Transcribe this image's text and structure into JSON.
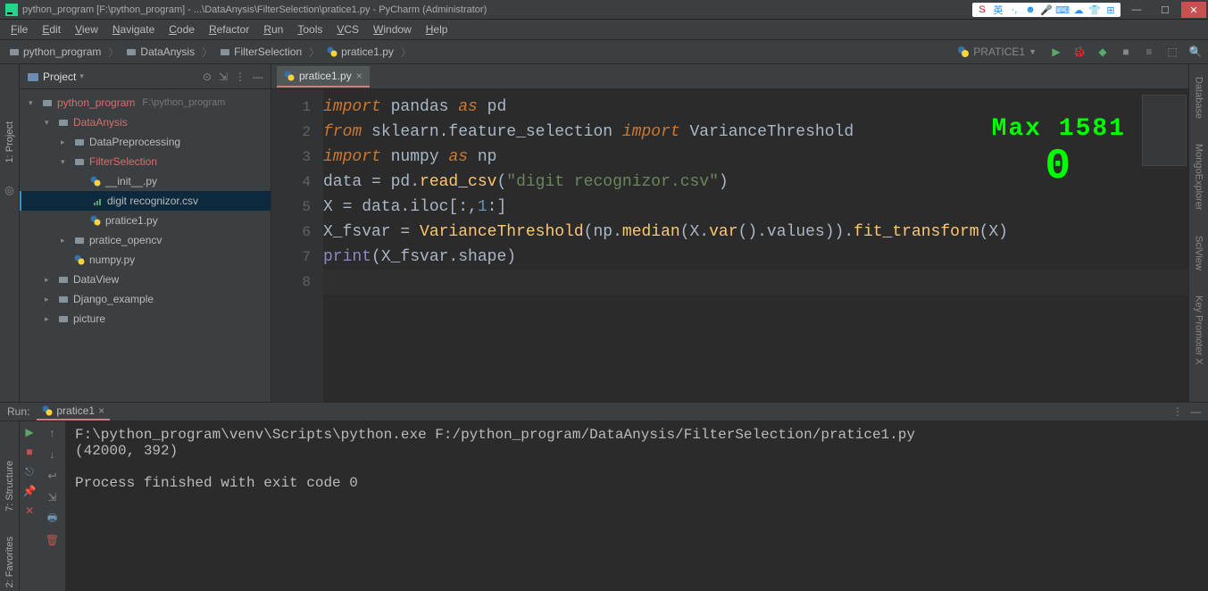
{
  "title": "python_program [F:\\python_program] - ...\\DataAnysis\\FilterSelection\\pratice1.py - PyCharm (Administrator)",
  "menu": [
    "File",
    "Edit",
    "View",
    "Navigate",
    "Code",
    "Refactor",
    "Run",
    "Tools",
    "VCS",
    "Window",
    "Help"
  ],
  "breadcrumbs": [
    {
      "icon": "folder",
      "label": "python_program"
    },
    {
      "icon": "folder",
      "label": "DataAnysis"
    },
    {
      "icon": "folder",
      "label": "FilterSelection"
    },
    {
      "icon": "python",
      "label": "pratice1.py"
    }
  ],
  "run_config": "PRATICE1",
  "project_header": "Project",
  "tree": [
    {
      "depth": 0,
      "arrow": "▾",
      "icon": "folder",
      "label": "python_program",
      "extra": "F:\\python_program",
      "cls": "root"
    },
    {
      "depth": 1,
      "arrow": "▾",
      "icon": "folder",
      "label": "DataAnysis",
      "cls": "folder-open"
    },
    {
      "depth": 2,
      "arrow": "▸",
      "icon": "folder",
      "label": "DataPreprocessing"
    },
    {
      "depth": 2,
      "arrow": "▾",
      "icon": "folder",
      "label": "FilterSelection",
      "cls": "folder-open"
    },
    {
      "depth": 3,
      "arrow": "",
      "icon": "python",
      "label": "__init__.py"
    },
    {
      "depth": 3,
      "arrow": "",
      "icon": "csv",
      "label": "digit recognizor.csv",
      "selected": true
    },
    {
      "depth": 3,
      "arrow": "",
      "icon": "python",
      "label": "pratice1.py"
    },
    {
      "depth": 2,
      "arrow": "▸",
      "icon": "folder",
      "label": "pratice_opencv"
    },
    {
      "depth": 2,
      "arrow": "",
      "icon": "python",
      "label": "numpy.py"
    },
    {
      "depth": 1,
      "arrow": "▸",
      "icon": "folder",
      "label": "DataView"
    },
    {
      "depth": 1,
      "arrow": "▸",
      "icon": "folder",
      "label": "Django_example"
    },
    {
      "depth": 1,
      "arrow": "▸",
      "icon": "folder",
      "label": "picture"
    }
  ],
  "editor_tab": "pratice1.py",
  "code": [
    [
      {
        "t": "import",
        "c": "kw"
      },
      {
        "t": " pandas "
      },
      {
        "t": "as",
        "c": "kw"
      },
      {
        "t": " pd"
      }
    ],
    [
      {
        "t": "from",
        "c": "kw"
      },
      {
        "t": " sklearn.feature_selection "
      },
      {
        "t": "import",
        "c": "kw"
      },
      {
        "t": " VarianceThreshold"
      }
    ],
    [
      {
        "t": "import",
        "c": "kw"
      },
      {
        "t": " numpy "
      },
      {
        "t": "as",
        "c": "kw"
      },
      {
        "t": " np"
      }
    ],
    [
      {
        "t": "data = pd."
      },
      {
        "t": "read_csv",
        "c": "fn"
      },
      {
        "t": "("
      },
      {
        "t": "\"digit recognizor.csv\"",
        "c": "str"
      },
      {
        "t": ")"
      }
    ],
    [
      {
        "t": "X = data.iloc[:,"
      },
      {
        "t": "1",
        "c": "num"
      },
      {
        "t": ":]"
      }
    ],
    [
      {
        "t": "X_fsvar = "
      },
      {
        "t": "VarianceThreshold",
        "c": "fn"
      },
      {
        "t": "(np."
      },
      {
        "t": "median",
        "c": "fn"
      },
      {
        "t": "(X."
      },
      {
        "t": "var",
        "c": "fn"
      },
      {
        "t": "().values))."
      },
      {
        "t": "fit_transform",
        "c": "fn"
      },
      {
        "t": "(X)"
      }
    ],
    [
      {
        "t": "print",
        "c": "builtin"
      },
      {
        "t": "(X_fsvar.shape)"
      }
    ],
    [
      {
        "t": ""
      }
    ]
  ],
  "overlay": {
    "line1": "Max 1581",
    "line2": "0"
  },
  "run_label": "Run:",
  "run_tab": "pratice1",
  "console": "F:\\python_program\\venv\\Scripts\\python.exe F:/python_program/DataAnysis/FilterSelection/pratice1.py\n(42000, 392)\n\nProcess finished with exit code 0",
  "left_rail": [
    "1: Project"
  ],
  "run_left_rail": [
    "7: Structure",
    "2: Favorites"
  ],
  "right_rail": [
    "Database",
    "MongoExplorer",
    "SciView",
    "Key Promoter X"
  ],
  "nav_tools": [
    {
      "name": "run",
      "color": "#59a869",
      "glyph": "▶"
    },
    {
      "name": "debug",
      "color": "#59a869",
      "glyph": "🐞"
    },
    {
      "name": "coverage",
      "color": "#59a869",
      "glyph": "◆"
    },
    {
      "name": "stop",
      "color": "#888",
      "glyph": "■"
    },
    {
      "name": "profile",
      "color": "#888",
      "glyph": "≡"
    },
    {
      "name": "update",
      "color": "#888",
      "glyph": "⬚"
    },
    {
      "name": "search",
      "color": "#3592c4",
      "glyph": "🔍"
    }
  ],
  "run_tools_col1": [
    {
      "name": "rerun",
      "color": "#59a869",
      "glyph": "▶"
    },
    {
      "name": "stop",
      "color": "#c75050",
      "glyph": "■"
    },
    {
      "name": "debug-attach",
      "color": "#6897bb",
      "glyph": "⎋"
    },
    {
      "name": "pin",
      "color": "#888",
      "glyph": "📌"
    },
    {
      "name": "close",
      "color": "#c75050",
      "glyph": "✕"
    }
  ],
  "run_tools_col2": [
    {
      "name": "up",
      "color": "#888",
      "glyph": "↑"
    },
    {
      "name": "down",
      "color": "#888",
      "glyph": "↓"
    },
    {
      "name": "soft-wrap",
      "color": "#888",
      "glyph": "↩"
    },
    {
      "name": "scroll-end",
      "color": "#888",
      "glyph": "⇲"
    },
    {
      "name": "print",
      "color": "#6897bb",
      "glyph": "🖶"
    },
    {
      "name": "trash",
      "color": "#c75050",
      "glyph": "🗑"
    }
  ],
  "ime_icons": [
    "S",
    "英",
    "·,",
    "☻",
    "🎤",
    "⌨",
    "☁",
    "👕",
    "⊞"
  ]
}
